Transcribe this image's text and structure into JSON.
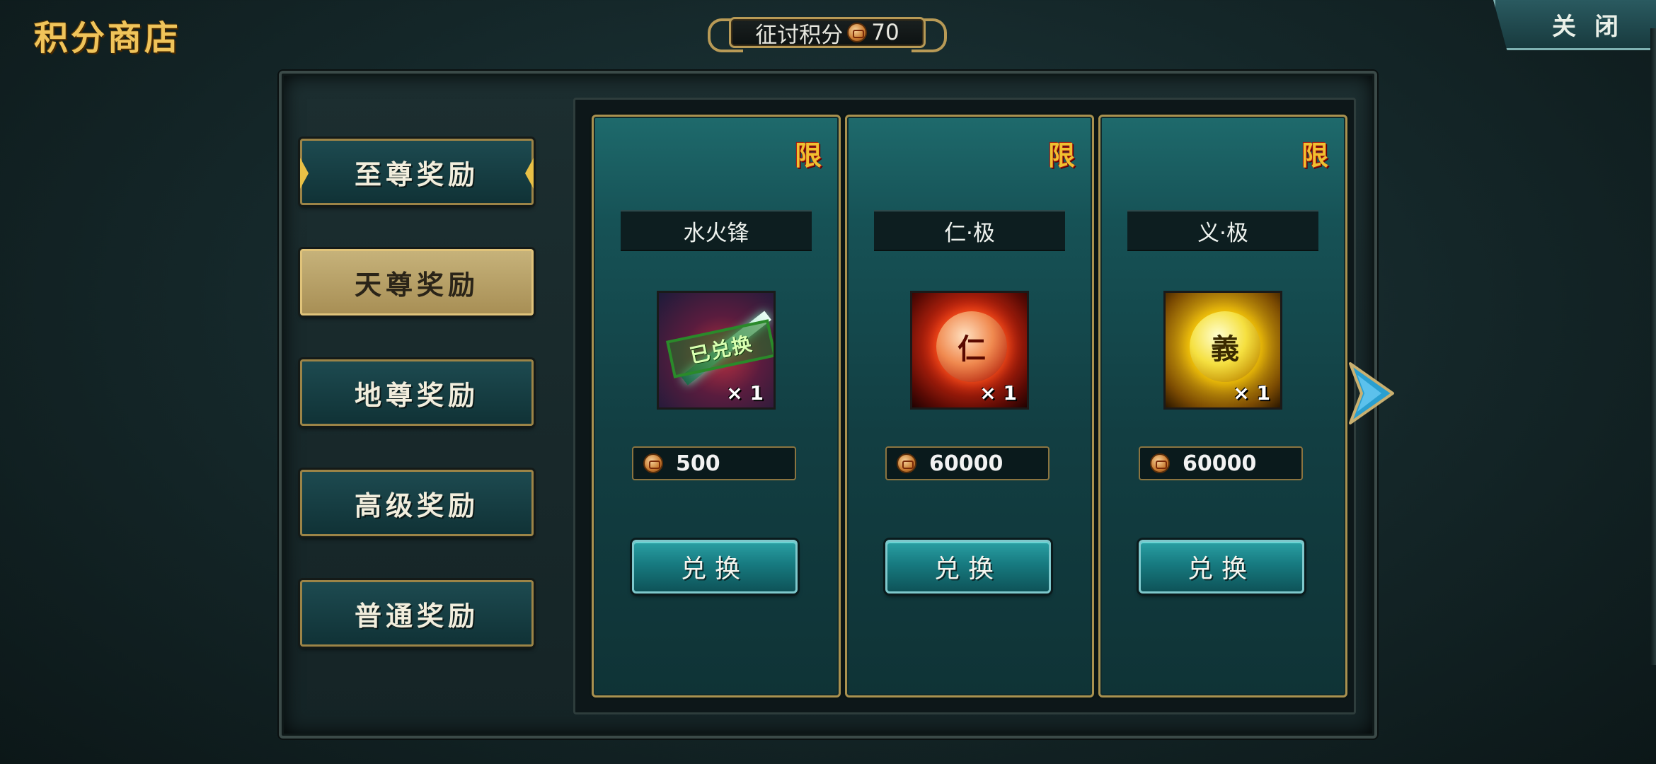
{
  "header": {
    "title": "积分商店",
    "points_label": "征讨积分",
    "points_value": "70",
    "close_label": "关闭"
  },
  "tabs": [
    {
      "label": "至尊奖励"
    },
    {
      "label": "天尊奖励"
    },
    {
      "label": "地尊奖励"
    },
    {
      "label": "高级奖励"
    },
    {
      "label": "普通奖励"
    }
  ],
  "active_tab": "天尊奖励",
  "items": [
    {
      "limit_badge": "限",
      "name": "水火锋",
      "quantity": "× 1",
      "stamp": "已兑换",
      "price": "500",
      "button": "兑换",
      "icon": "spear-icon"
    },
    {
      "limit_badge": "限",
      "name": "仁·极",
      "quantity": "× 1",
      "orb_char": "仁",
      "price": "60000",
      "button": "兑换",
      "icon": "ren-orb-icon"
    },
    {
      "limit_badge": "限",
      "name": "义·极",
      "quantity": "× 1",
      "orb_char": "義",
      "price": "60000",
      "button": "兑换",
      "icon": "yi-orb-icon"
    }
  ],
  "colors": {
    "accent_gold": "#f0c45a",
    "panel_teal": "#165256",
    "button_teal": "#177a80",
    "active_tab": "#c6b27a"
  },
  "icons": [
    "coin-icon",
    "next-arrow-icon"
  ]
}
